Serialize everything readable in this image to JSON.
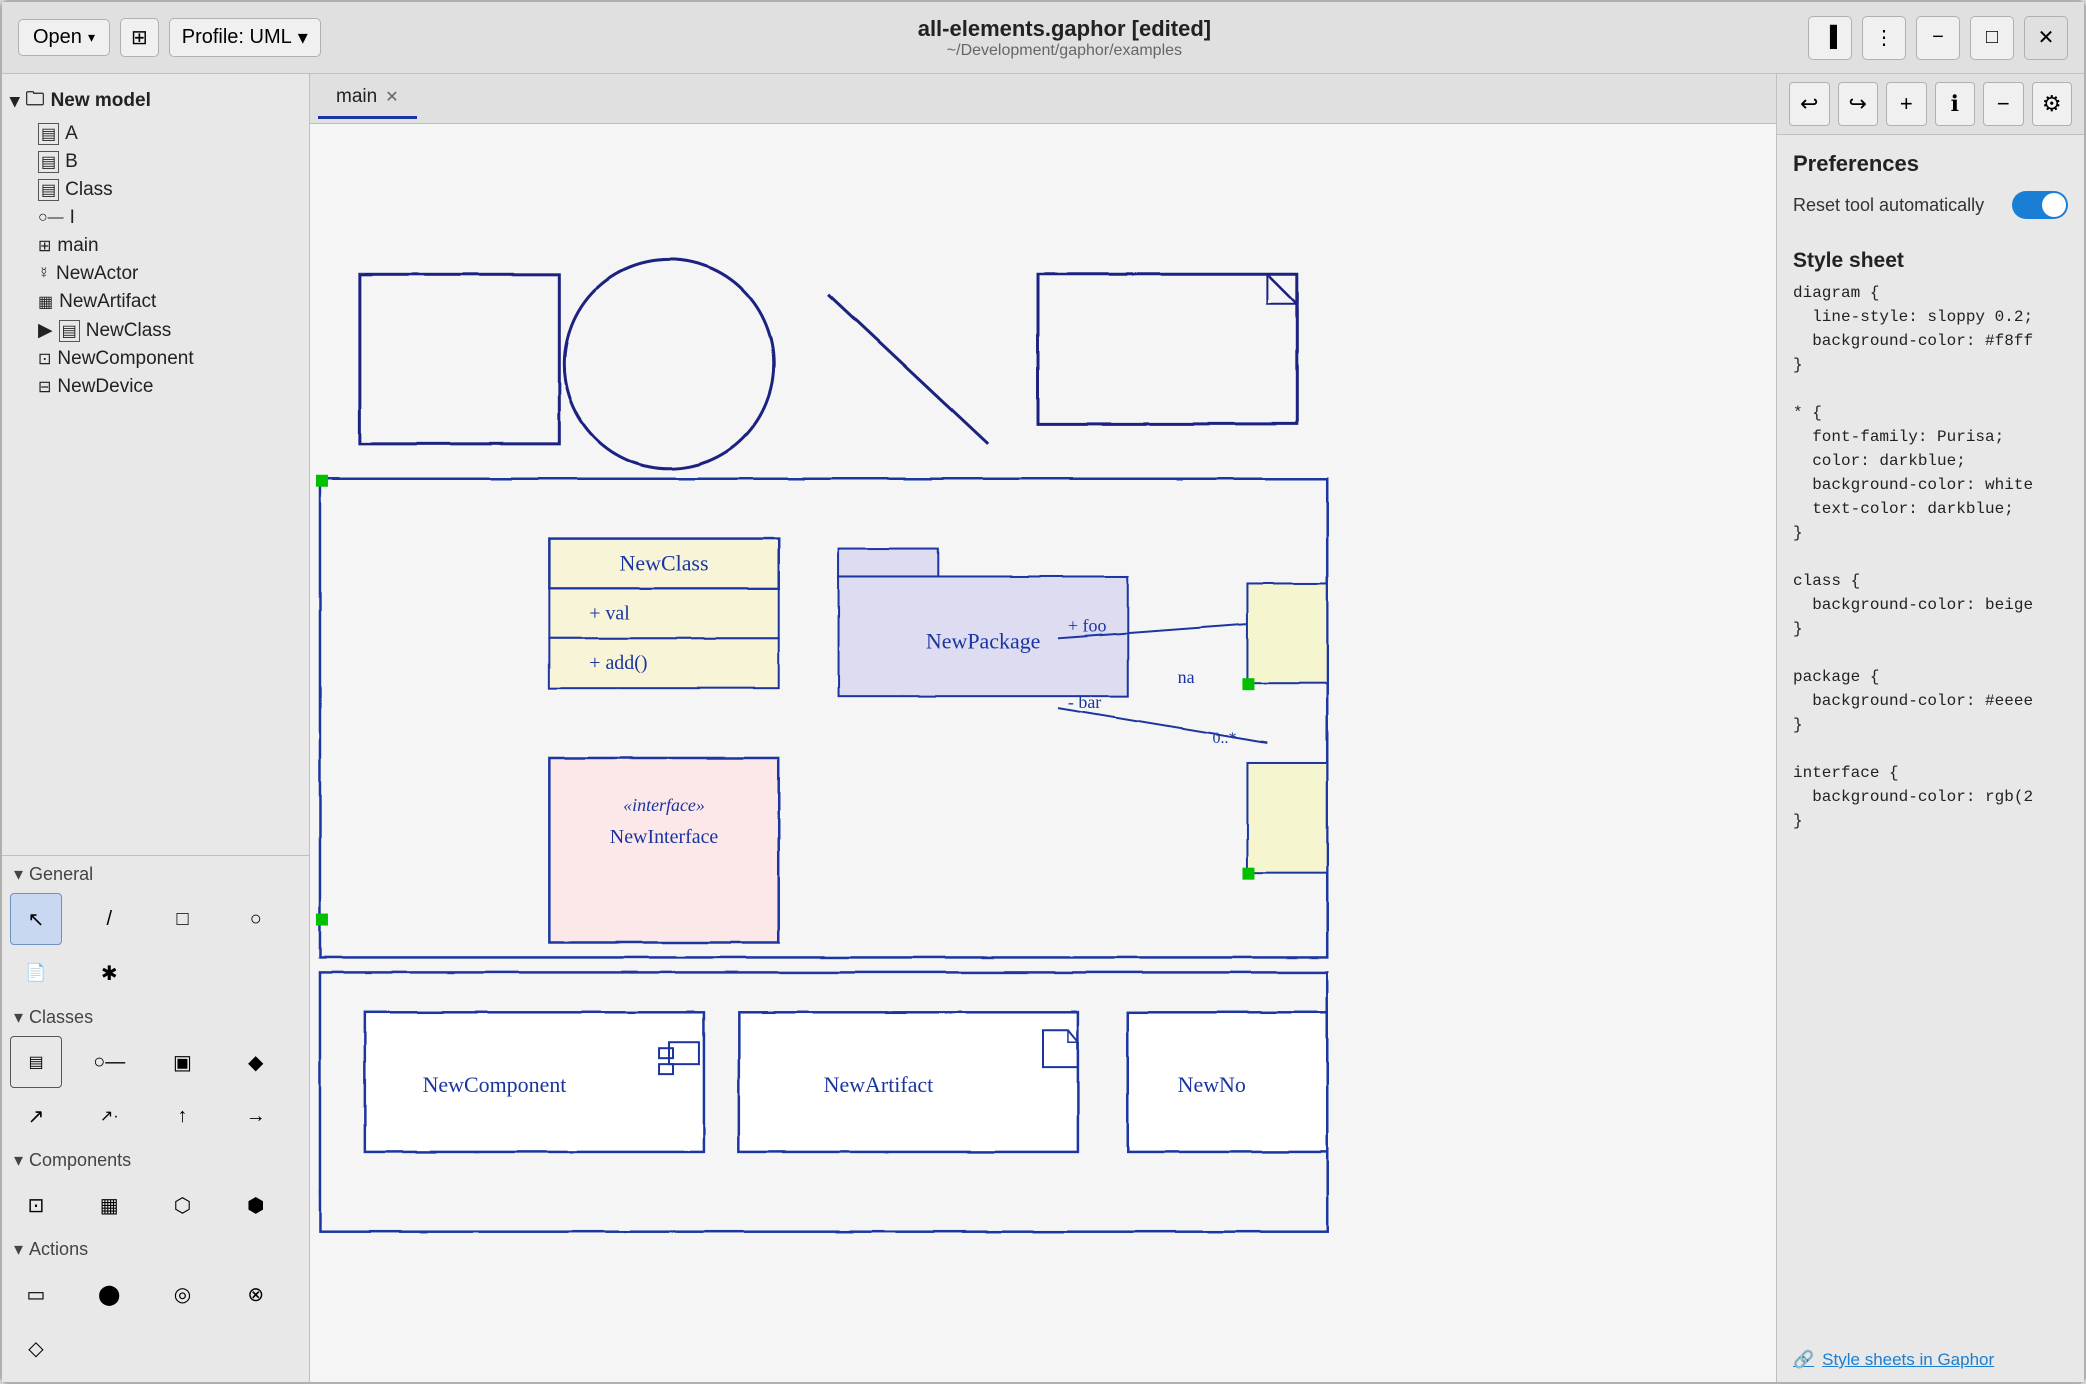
{
  "window": {
    "title": "all-elements.gaphor [edited]",
    "subtitle": "~/Development/gaphor/examples"
  },
  "titlebar": {
    "open_label": "Open",
    "profile_label": "Profile: UML",
    "layout_icon": "⊞",
    "undo_icon": "↩",
    "redo_icon": "↪",
    "add_icon": "+",
    "info_icon": "ℹ",
    "minus_icon": "−",
    "settings_icon": "⚙",
    "sidebar_icon": "▐",
    "menu_icon": "⋮",
    "minimize_icon": "−",
    "maximize_icon": "□",
    "close_icon": "✕"
  },
  "sidebar": {
    "model_name": "New model",
    "items": [
      {
        "label": "A",
        "icon": "▤",
        "indent": 1
      },
      {
        "label": "B",
        "icon": "▤",
        "indent": 1
      },
      {
        "label": "Class",
        "icon": "▤",
        "indent": 1
      },
      {
        "label": "I",
        "icon": "○—",
        "indent": 1
      },
      {
        "label": "main",
        "icon": "⊞",
        "indent": 1
      },
      {
        "label": "NewActor",
        "icon": "☿",
        "indent": 1
      },
      {
        "label": "NewArtifact",
        "icon": "▦",
        "indent": 1
      },
      {
        "label": "NewClass",
        "icon": "▤",
        "indent": 1,
        "expandable": true
      },
      {
        "label": "NewComponent",
        "icon": "⊡",
        "indent": 1
      },
      {
        "label": "NewDevice",
        "icon": "⊟",
        "indent": 1
      }
    ]
  },
  "toolpanels": [
    {
      "name": "General",
      "tools": [
        {
          "icon": "↖",
          "name": "pointer"
        },
        {
          "icon": "/",
          "name": "line"
        },
        {
          "icon": "□",
          "name": "rect"
        },
        {
          "icon": "○",
          "name": "ellipse"
        },
        {
          "icon": "📄",
          "name": "note"
        },
        {
          "icon": "✱",
          "name": "dot-line"
        }
      ]
    },
    {
      "name": "Classes",
      "tools": [
        {
          "icon": "▤",
          "name": "class"
        },
        {
          "icon": "○—",
          "name": "interface"
        },
        {
          "icon": "▣",
          "name": "package"
        },
        {
          "icon": "◆",
          "name": "dependency"
        },
        {
          "icon": "↗",
          "name": "generalization"
        },
        {
          "icon": "↗·",
          "name": "realization"
        },
        {
          "icon": "↑",
          "name": "association"
        },
        {
          "icon": "→",
          "name": "directed-assoc"
        }
      ]
    },
    {
      "name": "Components",
      "tools": [
        {
          "icon": "⊡",
          "name": "component"
        },
        {
          "icon": "▦",
          "name": "artifact"
        },
        {
          "icon": "⬡",
          "name": "node"
        },
        {
          "icon": "⬢",
          "name": "device"
        }
      ]
    },
    {
      "name": "Actions",
      "tools": [
        {
          "icon": "▭",
          "name": "action"
        },
        {
          "icon": "⬤",
          "name": "initial"
        },
        {
          "icon": "◎",
          "name": "final"
        },
        {
          "icon": "⊗",
          "name": "flow-final"
        },
        {
          "icon": "◇",
          "name": "decision"
        }
      ]
    }
  ],
  "tabs": [
    {
      "label": "main",
      "active": true
    }
  ],
  "preferences": {
    "title": "Preferences",
    "reset_tool_label": "Reset tool automatically",
    "reset_tool_value": true
  },
  "stylesheet": {
    "title": "Style sheet",
    "code": "diagram {\n  line-style: sloppy 0.2;\n  background-color: #f8ff\n}\n\n* {\n  font-family: Purisa;\n  color: darkblue;\n  background-color: white\n  text-color: darkblue;\n}\n\nclass {\n  background-color: beige\n}\n\npackage {\n  background-color: #eeee\n}\n\ninterface {\n  background-color: rgb(2\n}",
    "link_label": "Style sheets in Gaphor",
    "link_icon": "🔗"
  }
}
